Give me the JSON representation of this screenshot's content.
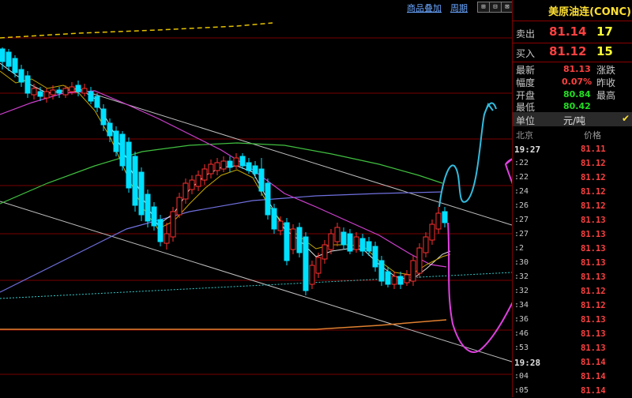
{
  "toolbar": {
    "product_overlay": "商品叠加",
    "period": "周期",
    "btn1": "⊞",
    "btn2": "⊟",
    "btn3": "⊠"
  },
  "quote": {
    "title": "美原油连(CONC)",
    "sell_label": "卖出",
    "sell_price": "81.14",
    "sell_vol": "17",
    "buy_label": "买入",
    "buy_price": "81.12",
    "buy_vol": "15",
    "latest_label": "最新",
    "latest_value": "81.13",
    "change_label": "涨跌",
    "change_value": "",
    "amplitude_label": "幅度",
    "amplitude_value": "0.07%",
    "prev_label": "昨收",
    "prev_value": "",
    "open_label": "开盘",
    "open_value": "80.84",
    "high_label": "最高",
    "high_value": "",
    "low_label": "最低",
    "low_value": "80.42",
    "unit_label": "单位",
    "unit_value": "元/吨",
    "col_place": "北京",
    "col_price": "价格"
  },
  "ticks": [
    {
      "time": "19:27",
      "price": "81.11",
      "bold": true
    },
    {
      "time": ":22",
      "price": "81.12"
    },
    {
      "time": ":22",
      "price": "81.12"
    },
    {
      "time": ":24",
      "price": "81.12"
    },
    {
      "time": ":26",
      "price": "81.12"
    },
    {
      "time": ":27",
      "price": "81.13"
    },
    {
      "time": ":27",
      "price": "81.13"
    },
    {
      "time": ":2",
      "price": "81.13"
    },
    {
      "time": ":30",
      "price": "81.13"
    },
    {
      "time": ":32",
      "price": "81.13"
    },
    {
      "time": ":32",
      "price": "81.12"
    },
    {
      "time": ":34",
      "price": "81.12"
    },
    {
      "time": ":36",
      "price": "81.13"
    },
    {
      "time": ":46",
      "price": "81.13"
    },
    {
      "time": ":53",
      "price": "81.13"
    },
    {
      "time": "19:28",
      "price": "81.14",
      "bold": true
    },
    {
      "time": ":04",
      "price": "81.14"
    },
    {
      "time": ":05",
      "price": "81.14"
    }
  ],
  "colors": {
    "up": "#ff4040",
    "down": "#00e0ff",
    "accent": "#ffe033",
    "grid": "#8b0000"
  }
}
